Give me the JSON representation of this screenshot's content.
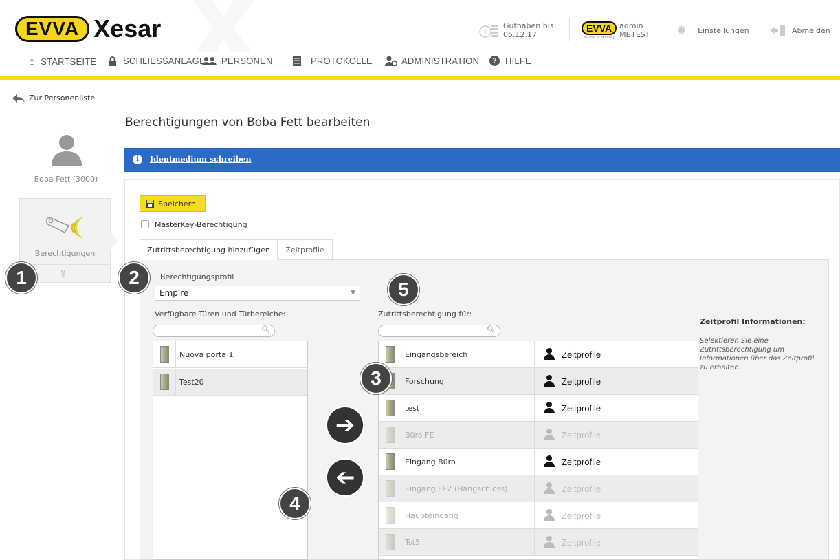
{
  "header": {
    "brand_badge": "EVVA",
    "product": "Xesar",
    "credit_label": "Guthaben bis",
    "credit_date": "05.12.17",
    "user_logo": "EVVA",
    "user_logo_sub": "access to security",
    "user_name": "admin",
    "user_site": "MBTEST",
    "settings": "Einstellungen",
    "logout": "Abmelden",
    "accent": "#f5dc1e"
  },
  "nav": {
    "items": [
      {
        "label": "STARTSEITE",
        "icon": "home-icon"
      },
      {
        "label": "SCHLIESSANLAGE",
        "icon": "lock-icon"
      },
      {
        "label": "PERSONEN",
        "icon": "people-icon"
      },
      {
        "label": "PROTOKOLLE",
        "icon": "document-icon"
      },
      {
        "label": "ADMINISTRATION",
        "icon": "admin-icon"
      },
      {
        "label": "HILFE",
        "icon": "help-icon"
      }
    ]
  },
  "back_link": "Zur Personenliste",
  "page_title": "Berechtigungen von Boba Fett bearbeiten",
  "sidebar": {
    "person": "Boba Fett (3000)",
    "card_label": "Berechtigungen"
  },
  "banner": {
    "link": "Identmedium schreiben",
    "color": "#2b6bc6"
  },
  "form": {
    "save": "Speichern",
    "masterkey": "MasterKey-Berechtigung",
    "tabs": [
      "Zutrittsberechtigung hinzufügen",
      "Zeitprofile"
    ],
    "profile_label": "Berechtigungsprofil",
    "profile_value": "Empire",
    "available_label": "Verfügbare Türen und Türbereiche:",
    "access_label": "Zutrittsberechtigung für:",
    "available": [
      "Nuova porta 1",
      "Test20"
    ],
    "access": [
      {
        "name": "Eingangsbereich",
        "profile": "Zeitprofile",
        "enabled": true
      },
      {
        "name": "Forschung",
        "profile": "Zeitprofile",
        "enabled": true
      },
      {
        "name": "test",
        "profile": "Zeitprofile",
        "enabled": true
      },
      {
        "name": "Büro FE",
        "profile": "Zeitprofile",
        "enabled": false
      },
      {
        "name": "Eingang Büro",
        "profile": "Zeitprofile",
        "enabled": true
      },
      {
        "name": "Eingang FE2 (Hangschloss)",
        "profile": "Zeitprofile",
        "enabled": false
      },
      {
        "name": "Haupteingang",
        "profile": "Zeitprofile",
        "enabled": false
      },
      {
        "name": "Tst5",
        "profile": "Zeitprofile",
        "enabled": false
      }
    ],
    "info_title": "Zeitprofil Informationen:",
    "info_text": "Selektieren Sie eine Zutrittsberechtigung um Informationen über das Zeitprofil zu erhalten."
  },
  "annotations": [
    "1",
    "2",
    "3",
    "4",
    "5"
  ]
}
